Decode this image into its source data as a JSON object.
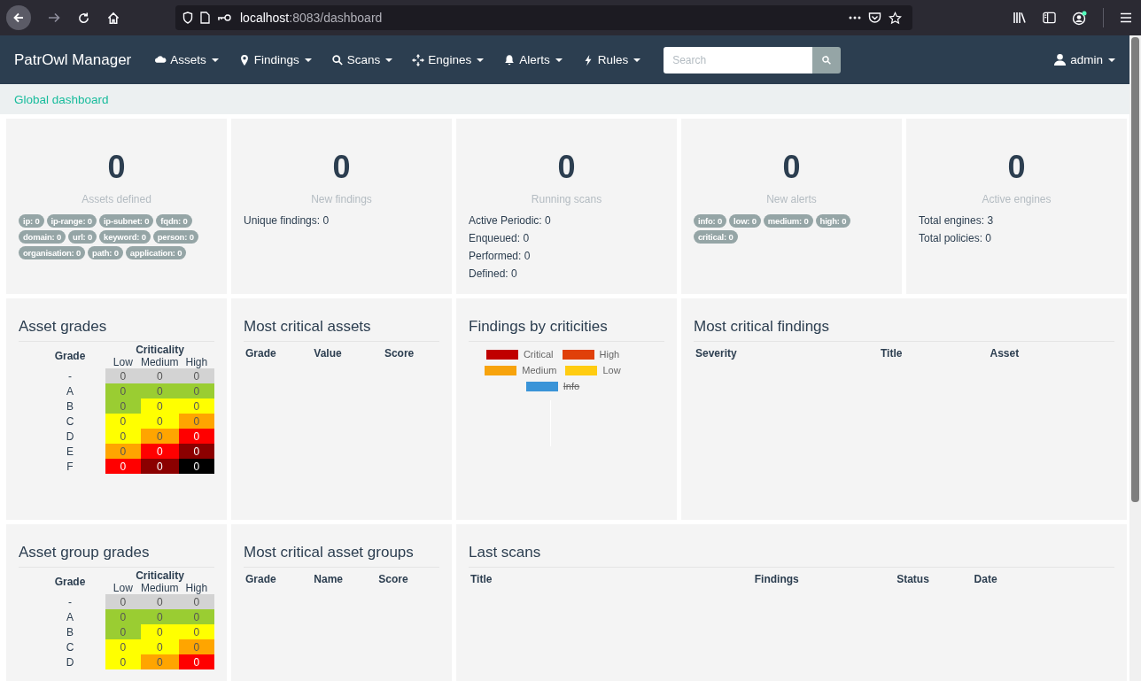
{
  "browser": {
    "url_host": "localhost",
    "url_rest": ":8083/dashboard"
  },
  "navbar": {
    "brand": "PatrOwl Manager",
    "menus": [
      {
        "label": "Assets"
      },
      {
        "label": "Findings"
      },
      {
        "label": "Scans"
      },
      {
        "label": "Engines"
      },
      {
        "label": "Alerts"
      },
      {
        "label": "Rules"
      }
    ],
    "search": {
      "placeholder": "Search"
    },
    "user": "admin"
  },
  "breadcrumb": "Global dashboard",
  "stats": [
    {
      "value": "0",
      "label": "Assets defined",
      "kind": "badges",
      "items": [
        "ip: 0",
        "ip-range: 0",
        "ip-subnet: 0",
        "fqdn: 0",
        "domain: 0",
        "url: 0",
        "keyword: 0",
        "person: 0",
        "organisation: 0",
        "path: 0",
        "application: 0"
      ]
    },
    {
      "value": "0",
      "label": "New findings",
      "kind": "lines",
      "items": [
        "Unique findings: 0"
      ]
    },
    {
      "value": "0",
      "label": "Running scans",
      "kind": "lines",
      "items": [
        "Active Periodic: 0",
        "Enqueued: 0",
        "Performed: 0",
        "Defined: 0"
      ]
    },
    {
      "value": "0",
      "label": "New alerts",
      "kind": "badges",
      "items": [
        "info: 0",
        "low: 0",
        "medium: 0",
        "high: 0",
        "critical: 0"
      ]
    },
    {
      "value": "0",
      "label": "Active engines",
      "kind": "lines",
      "items": [
        "Total engines: 3",
        "Total policies: 0"
      ]
    }
  ],
  "asset_grades": {
    "title": "Asset grades",
    "grade_header": "Grade",
    "criticality_header": "Criticality",
    "columns": [
      "Low",
      "Medium",
      "High"
    ],
    "rows": [
      {
        "grade": "-",
        "cells": [
          {
            "value": "0",
            "color": "#d3d3d3"
          },
          {
            "value": "0",
            "color": "#d3d3d3"
          },
          {
            "value": "0",
            "color": "#d3d3d3"
          }
        ]
      },
      {
        "grade": "A",
        "cells": [
          {
            "value": "0",
            "color": "#9acd32"
          },
          {
            "value": "0",
            "color": "#9acd32"
          },
          {
            "value": "0",
            "color": "#9acd32"
          }
        ]
      },
      {
        "grade": "B",
        "cells": [
          {
            "value": "0",
            "color": "#9acd32"
          },
          {
            "value": "0",
            "color": "#ffff00"
          },
          {
            "value": "0",
            "color": "#ffff00"
          }
        ]
      },
      {
        "grade": "C",
        "cells": [
          {
            "value": "0",
            "color": "#ffff00"
          },
          {
            "value": "0",
            "color": "#ffff00"
          },
          {
            "value": "0",
            "color": "#ffa500"
          }
        ]
      },
      {
        "grade": "D",
        "cells": [
          {
            "value": "0",
            "color": "#ffff00"
          },
          {
            "value": "0",
            "color": "#ffa500"
          },
          {
            "value": "0",
            "color": "#ff0000"
          }
        ]
      },
      {
        "grade": "E",
        "cells": [
          {
            "value": "0",
            "color": "#ffa500"
          },
          {
            "value": "0",
            "color": "#ff0000"
          },
          {
            "value": "0",
            "color": "#8b0000"
          }
        ]
      },
      {
        "grade": "F",
        "cells": [
          {
            "value": "0",
            "color": "#ff0000"
          },
          {
            "value": "0",
            "color": "#8b0000"
          },
          {
            "value": "0",
            "color": "#000000"
          }
        ]
      }
    ]
  },
  "most_critical_assets": {
    "title": "Most critical assets",
    "columns": [
      "Grade",
      "Value",
      "Score"
    ]
  },
  "findings_by_criticities": {
    "title": "Findings by criticities",
    "legend": [
      {
        "label": "Critical",
        "color": "#c00000",
        "hidden": false
      },
      {
        "label": "High",
        "color": "#e0400a",
        "hidden": false
      },
      {
        "label": "Medium",
        "color": "#f7a30c",
        "hidden": false
      },
      {
        "label": "Low",
        "color": "#ffcc11",
        "hidden": false
      },
      {
        "label": "Info",
        "color": "#3a94d8",
        "hidden": true
      }
    ]
  },
  "most_critical_findings": {
    "title": "Most critical findings",
    "columns": [
      "Severity",
      "Title",
      "Asset"
    ]
  },
  "asset_group_grades": {
    "title": "Asset group grades",
    "grade_header": "Grade",
    "criticality_header": "Criticality",
    "columns": [
      "Low",
      "Medium",
      "High"
    ],
    "rows": [
      {
        "grade": "-",
        "cells": [
          {
            "value": "0",
            "color": "#d3d3d3"
          },
          {
            "value": "0",
            "color": "#d3d3d3"
          },
          {
            "value": "0",
            "color": "#d3d3d3"
          }
        ]
      },
      {
        "grade": "A",
        "cells": [
          {
            "value": "0",
            "color": "#9acd32"
          },
          {
            "value": "0",
            "color": "#9acd32"
          },
          {
            "value": "0",
            "color": "#9acd32"
          }
        ]
      },
      {
        "grade": "B",
        "cells": [
          {
            "value": "0",
            "color": "#9acd32"
          },
          {
            "value": "0",
            "color": "#ffff00"
          },
          {
            "value": "0",
            "color": "#ffff00"
          }
        ]
      },
      {
        "grade": "C",
        "cells": [
          {
            "value": "0",
            "color": "#ffff00"
          },
          {
            "value": "0",
            "color": "#ffff00"
          },
          {
            "value": "0",
            "color": "#ffa500"
          }
        ]
      },
      {
        "grade": "D",
        "cells": [
          {
            "value": "0",
            "color": "#ffff00"
          },
          {
            "value": "0",
            "color": "#ffa500"
          },
          {
            "value": "0",
            "color": "#ff0000"
          }
        ]
      }
    ]
  },
  "most_critical_asset_groups": {
    "title": "Most critical asset groups",
    "columns": [
      "Grade",
      "Name",
      "Score"
    ]
  },
  "last_scans": {
    "title": "Last scans",
    "columns": [
      "Title",
      "Findings",
      "Status",
      "Date"
    ]
  }
}
